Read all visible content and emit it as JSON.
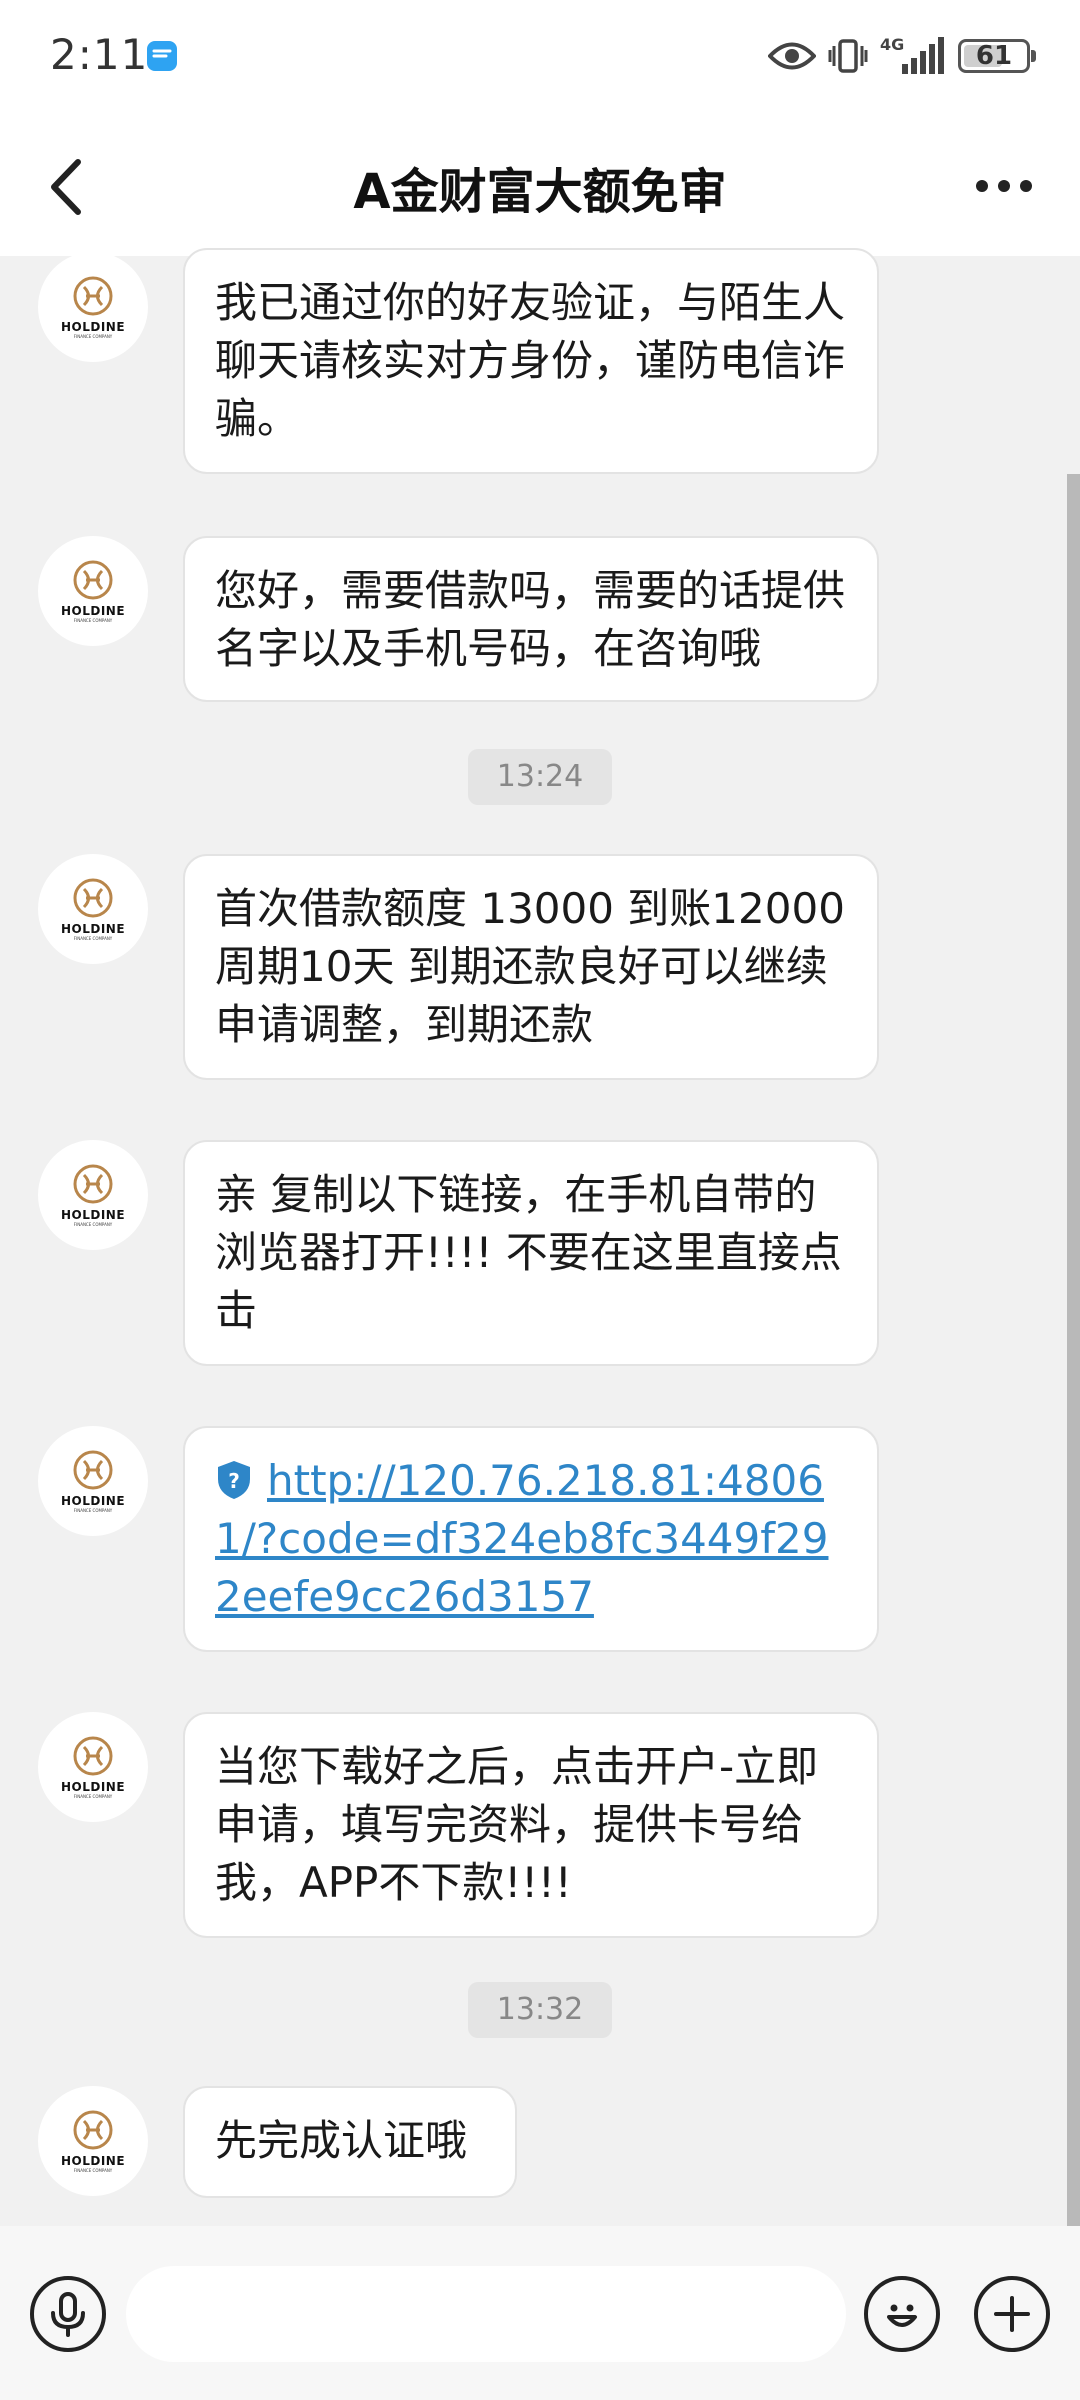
{
  "status": {
    "time": "2:11",
    "signal": "4G",
    "battery": "61"
  },
  "header": {
    "title": "A金财富大额免审"
  },
  "avatar": {
    "brand": "HOLDINE",
    "sub": "FINANCE COMPANY"
  },
  "messages": [
    {
      "text": "我已通过你的好友验证，与陌生人聊天请核实对方身份，谨防电信诈骗。"
    },
    {
      "text": "您好，需要借款吗，需要的话提供名字以及手机号码，在咨询哦"
    },
    {
      "text": "首次借款额度 13000 到账12000 周期10天 到期还款良好可以继续申请调整，到期还款"
    },
    {
      "text": "亲 复制以下链接，在手机自带的浏览器打开!!!! 不要在这里直接点击"
    },
    {
      "text": "http://120.76.218.81:48061/?code=df324eb8fc3449f292eefe9cc26d3157"
    },
    {
      "text": "当您下载好之后，点击开户-立即申请，填写完资料，提供卡号给我，APP不下款!!!!"
    },
    {
      "text": "先完成认证哦"
    }
  ],
  "timestamps": [
    "13:24",
    "13:32"
  ],
  "input": {
    "placeholder": ""
  },
  "colors": {
    "link": "#2e86c8",
    "avatar_gold": "#b8864b",
    "background": "#f1f1f1"
  }
}
